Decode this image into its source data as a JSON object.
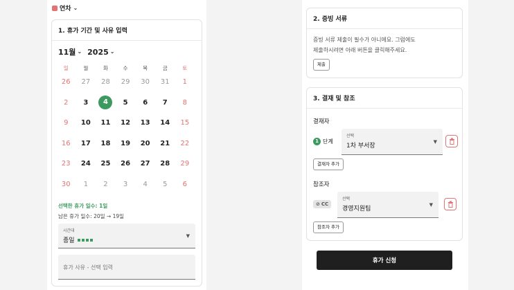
{
  "leave_type": {
    "label": "연차"
  },
  "period_card": {
    "title": "1. 휴가 기간 및 사유 입력",
    "month": "11월",
    "year": "2025",
    "weekdays": [
      "일",
      "월",
      "화",
      "수",
      "목",
      "금",
      "토"
    ],
    "weeks": [
      [
        "26",
        "27",
        "28",
        "29",
        "30",
        "31",
        "1"
      ],
      [
        "2",
        "3",
        "4",
        "5",
        "6",
        "7",
        "8"
      ],
      [
        "9",
        "10",
        "11",
        "12",
        "13",
        "14",
        "15"
      ],
      [
        "16",
        "17",
        "18",
        "19",
        "20",
        "21",
        "22"
      ],
      [
        "23",
        "24",
        "25",
        "26",
        "27",
        "28",
        "29"
      ],
      [
        "30",
        "1",
        "2",
        "3",
        "4",
        "5",
        "6"
      ]
    ],
    "selected_day": "4",
    "selected_days_text": "선택한 휴가 일수: 1일",
    "remaining_text": "남은 휴가 일수: 20일 → 19일",
    "time_select": {
      "label": "시간대",
      "value": "종일"
    },
    "reason_placeholder": "휴가 사유 - 선택 입력"
  },
  "docs_card": {
    "title": "2. 증빙 서류",
    "text_line1": "증빙 서류 제출이 필수가 아니에요. 그럼에도",
    "text_line2": "제출하시려면 아래 버튼을 클릭해주세요.",
    "submit_label": "제출"
  },
  "approval_card": {
    "title": "3. 결재 및 참조",
    "approver_title": "결재자",
    "step_num": "1",
    "step_label": "단계",
    "approver_select": {
      "label": "선택",
      "value": "1차 부서장"
    },
    "add_approver_label": "결재자 추가",
    "ref_title": "참조자",
    "cc_label": "CC",
    "ref_select": {
      "label": "선택",
      "value": "경영지원팀"
    },
    "add_ref_label": "참조자 추가"
  },
  "apply_label": "휴가 신청",
  "colors": {
    "accent": "#3c9a5f",
    "weekend": "#e57373",
    "button_dark": "#1f1f1f"
  }
}
